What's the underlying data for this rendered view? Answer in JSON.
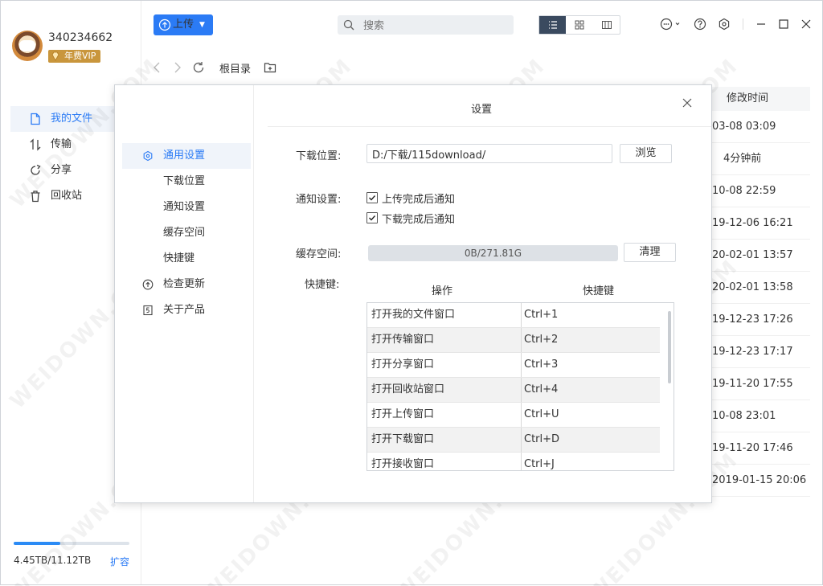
{
  "user": {
    "name": "340234662",
    "badge": "年费VIP"
  },
  "sidebar": {
    "items": [
      {
        "label": "我的文件",
        "icon": "file-icon",
        "active": true
      },
      {
        "label": "传输",
        "icon": "transfer-icon",
        "active": false
      },
      {
        "label": "分享",
        "icon": "share-icon",
        "active": false
      },
      {
        "label": "回收站",
        "icon": "trash-icon",
        "active": false
      }
    ],
    "storage": {
      "text": "4.45TB/11.12TB",
      "used_fraction": 0.4,
      "expand_label": "扩容"
    }
  },
  "toolbar": {
    "upload_label": "上传",
    "search_placeholder": "搜索",
    "views": [
      "list-view-icon",
      "grid-view-icon",
      "column-view-icon"
    ]
  },
  "breadcrumb": {
    "root": "根目录"
  },
  "file_list": {
    "column_header": "修改时间",
    "times": [
      "03-08 03:09",
      "4分钟前",
      "10-08 22:59",
      "19-12-06 16:21",
      "20-02-01 13:57",
      "20-02-01 13:58",
      "19-12-23 17:26",
      "19-12-23 17:17",
      "19-11-20 17:55",
      "10-08 23:01",
      "19-11-20 17:46",
      "2019-01-15 20:06"
    ]
  },
  "settings": {
    "title": "设置",
    "nav": [
      {
        "label": "通用设置",
        "active": true,
        "icon": "general-settings-icon"
      },
      {
        "label": "下载位置",
        "active": false,
        "icon": ""
      },
      {
        "label": "通知设置",
        "active": false,
        "icon": ""
      },
      {
        "label": "缓存空间",
        "active": false,
        "icon": ""
      },
      {
        "label": "快捷键",
        "active": false,
        "icon": ""
      },
      {
        "label": "检查更新",
        "active": false,
        "icon": "update-icon"
      },
      {
        "label": "关于产品",
        "active": false,
        "icon": "about-icon"
      }
    ],
    "download": {
      "label": "下载位置:",
      "path": "D:/下载/115download/",
      "browse_label": "浏览"
    },
    "notify": {
      "label": "通知设置:",
      "options": [
        {
          "label": "上传完成后通知",
          "checked": true
        },
        {
          "label": "下载完成后通知",
          "checked": true
        }
      ]
    },
    "cache": {
      "label": "缓存空间:",
      "usage": "0B/271.81G",
      "clear_label": "清理"
    },
    "shortcuts": {
      "label": "快捷键:",
      "col_action": "操作",
      "col_key": "快捷键",
      "rows": [
        {
          "action": "打开我的文件窗口",
          "key": "Ctrl+1"
        },
        {
          "action": "打开传输窗口",
          "key": "Ctrl+2"
        },
        {
          "action": "打开分享窗口",
          "key": "Ctrl+3"
        },
        {
          "action": "打开回收站窗口",
          "key": "Ctrl+4"
        },
        {
          "action": "打开上传窗口",
          "key": "Ctrl+U"
        },
        {
          "action": "打开下载窗口",
          "key": "Ctrl+D"
        },
        {
          "action": "打开接收窗口",
          "key": "Ctrl+J"
        }
      ]
    }
  },
  "colors": {
    "accent": "#2b7bf5",
    "vip": "#c9963c",
    "active_bg": "#f0f4fa"
  }
}
